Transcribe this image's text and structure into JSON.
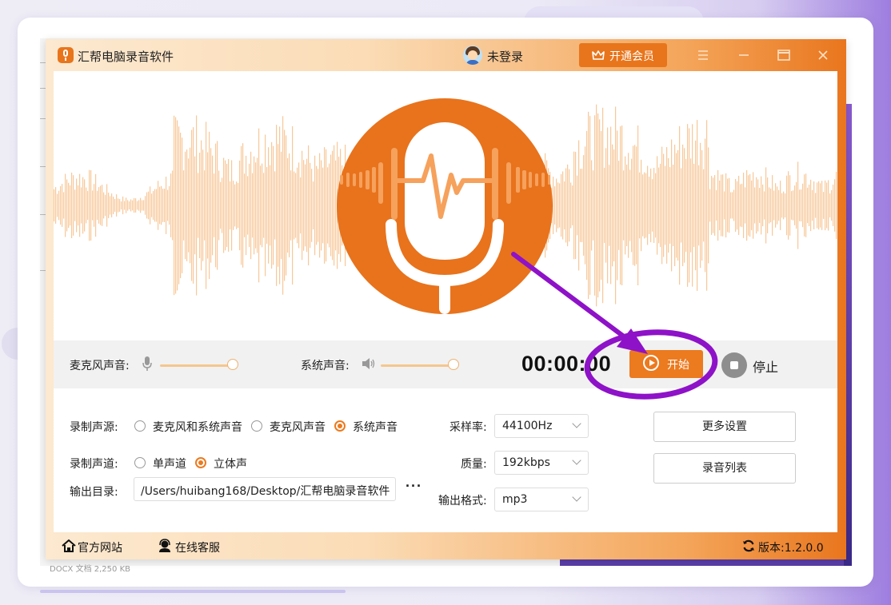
{
  "app": {
    "title": "汇帮电脑录音软件",
    "user_status": "未登录",
    "vip_button": "开通会员"
  },
  "controls": {
    "mic_label": "麦克风声音:",
    "mic_level": 1.0,
    "system_label": "系统声音:",
    "system_level": 1.0,
    "timer": "00:00:00",
    "start_label": "开始",
    "stop_label": "停止"
  },
  "settings": {
    "source_label": "录制声源:",
    "source_options": [
      "麦克风和系统声音",
      "麦克风声音",
      "系统声音"
    ],
    "source_selected": "系统声音",
    "channel_label": "录制声道:",
    "channel_options": [
      "单声道",
      "立体声"
    ],
    "channel_selected": "立体声",
    "output_dir_label": "输出目录:",
    "output_dir_value": "/Users/huibang168/Desktop/汇帮电脑录音软件",
    "more_label": "···",
    "sample_rate_label": "采样率:",
    "sample_rate_value": "44100Hz",
    "quality_label": "质量:",
    "quality_value": "192kbps",
    "format_label": "输出格式:",
    "format_value": "mp3",
    "more_settings_button": "更多设置",
    "record_list_button": "录音列表"
  },
  "footer": {
    "website": "官方网站",
    "support": "在线客服",
    "version": "版本:1.2.0.0"
  },
  "colors": {
    "accent": "#ec7a1f",
    "annotation": "#8e12c8",
    "wave": "#f7c89a"
  },
  "background": {
    "doc_text": "DOCX 文档     2,250 KB"
  }
}
